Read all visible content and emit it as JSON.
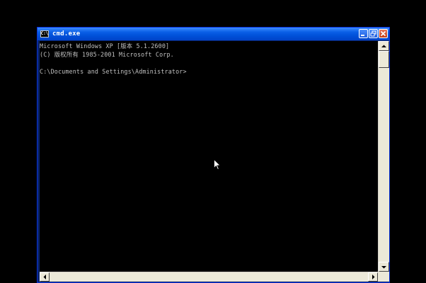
{
  "window": {
    "title": "cmd.exe",
    "icon": "console-icon",
    "icon_label": "C:\\",
    "buttons": [
      "minimize-icon",
      "restore-icon",
      "close-icon"
    ]
  },
  "console": {
    "lines": [
      "Microsoft Windows XP [版本 5.1.2600]",
      "(C) 版权所有 1985-2001 Microsoft Corp.",
      "",
      "C:\\Documents and Settings\\Administrator>"
    ]
  },
  "colors": {
    "desktop": "#000000",
    "titlebar": "#0050d8",
    "console_bg": "#000000",
    "console_text": "#c0c0c0",
    "scrollbar": "#ece9d8"
  },
  "mouse_cursor": "arrow-cursor-icon"
}
